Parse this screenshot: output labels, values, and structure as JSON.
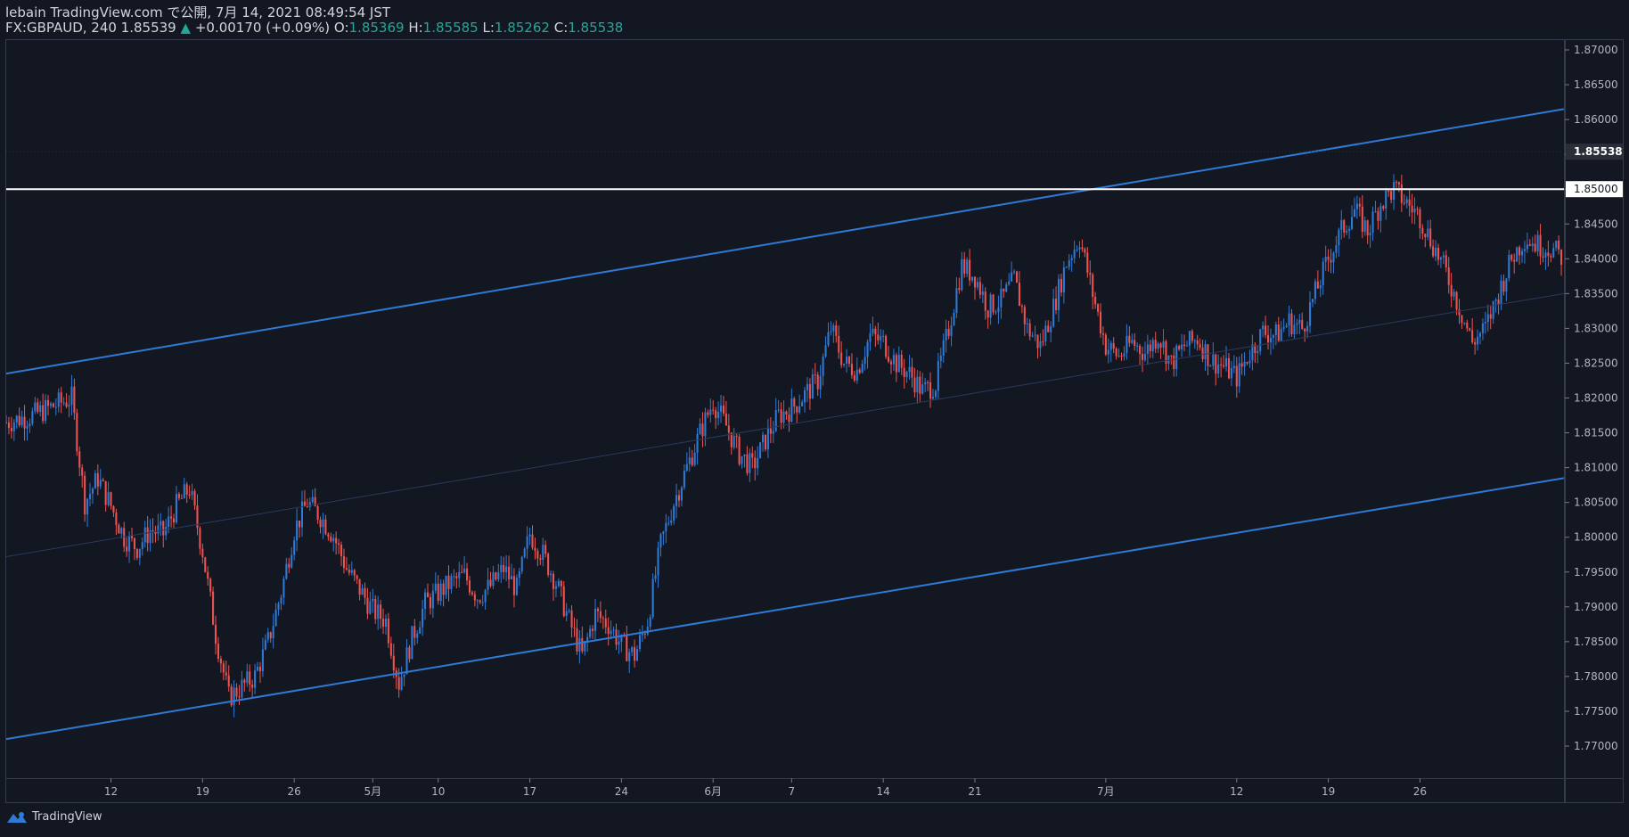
{
  "header": {
    "line1": "lebain TradingView.com で公開, 7月 14, 2021 08:49:54 JST",
    "symbol_prefix": "FX:GBPAUD, 240 1.85539",
    "change_arrow": "▲",
    "change": "+0.00170 (+0.09%)",
    "o_label": "O:",
    "o_value": "1.85369",
    "h_label": "H:",
    "h_value": "1.85585",
    "l_label": "L:",
    "l_value": "1.85262",
    "c_label": "C:",
    "c_value": "1.85538"
  },
  "footer": {
    "brand": "TradingView",
    "logo_icon": "tradingview-logo-icon"
  },
  "colors": {
    "background": "#131722",
    "up": "#2f7ad6",
    "down": "#ef5350",
    "trendline": "#2f7ad6",
    "level": "#ffffff",
    "text": "#d1d4dc",
    "teal": "#26a69a"
  },
  "chart_data": {
    "type": "candlestick",
    "symbol": "FX:GBPAUD",
    "interval": "240",
    "ylim": [
      1.765,
      1.874
    ],
    "y_ticks": [
      "1.87000",
      "1.86500",
      "1.86000",
      "1.85500",
      "1.85000",
      "1.84500",
      "1.84000",
      "1.83500",
      "1.83000",
      "1.82500",
      "1.82000",
      "1.81500",
      "1.81000",
      "1.80500",
      "1.80000",
      "1.79500",
      "1.79000",
      "1.78500",
      "1.78000",
      "1.77500",
      "1.77000"
    ],
    "x_ticks": [
      {
        "label": "12",
        "day": 12
      },
      {
        "label": "19",
        "day": 19
      },
      {
        "label": "26",
        "day": 26
      },
      {
        "label": "5月",
        "day": 32
      },
      {
        "label": "10",
        "day": 37
      },
      {
        "label": "17",
        "day": 44
      },
      {
        "label": "24",
        "day": 51
      },
      {
        "label": "6月",
        "day": 58
      },
      {
        "label": "7",
        "day": 64
      },
      {
        "label": "14",
        "day": 71
      },
      {
        "label": "21",
        "day": 78
      },
      {
        "label": "7月",
        "day": 88
      },
      {
        "label": "12",
        "day": 98
      },
      {
        "label": "19",
        "day": 105
      },
      {
        "label": "26",
        "day": 112
      }
    ],
    "x_range_days": [
      4,
      123
    ],
    "last_price_label": "1.85538",
    "horizontal_level": {
      "price": 1.85,
      "label": "1.85000"
    },
    "channel_lines": [
      {
        "name": "upper",
        "p1": {
          "day": 4,
          "price": 1.8235
        },
        "p2": {
          "day": 123,
          "price": 1.8615
        }
      },
      {
        "name": "lower",
        "p1": {
          "day": 4,
          "price": 1.771
        },
        "p2": {
          "day": 123,
          "price": 1.8085
        }
      },
      {
        "name": "mid",
        "p1": {
          "day": 4,
          "price": 1.7972
        },
        "p2": {
          "day": 123,
          "price": 1.835
        }
      }
    ],
    "close_path": [
      [
        4,
        1.8165
      ],
      [
        6,
        1.8175
      ],
      [
        8,
        1.8192
      ],
      [
        9,
        1.82
      ],
      [
        10,
        1.805
      ],
      [
        11,
        1.8085
      ],
      [
        12,
        1.8045
      ],
      [
        13,
        1.8
      ],
      [
        14,
        1.7985
      ],
      [
        15,
        1.801
      ],
      [
        16,
        1.8005
      ],
      [
        17,
        1.8045
      ],
      [
        18,
        1.807
      ],
      [
        19,
        1.798
      ],
      [
        20,
        1.786
      ],
      [
        21,
        1.777
      ],
      [
        22,
        1.7785
      ],
      [
        23,
        1.78
      ],
      [
        24,
        1.785
      ],
      [
        25,
        1.792
      ],
      [
        26,
        1.801
      ],
      [
        27,
        1.805
      ],
      [
        28,
        1.803
      ],
      [
        29,
        1.8002
      ],
      [
        30,
        1.7955
      ],
      [
        31,
        1.7925
      ],
      [
        32,
        1.7895
      ],
      [
        33,
        1.788
      ],
      [
        34,
        1.779
      ],
      [
        35,
        1.7855
      ],
      [
        36,
        1.7905
      ],
      [
        37,
        1.792
      ],
      [
        38,
        1.7935
      ],
      [
        39,
        1.7945
      ],
      [
        40,
        1.7915
      ],
      [
        41,
        1.793
      ],
      [
        42,
        1.7955
      ],
      [
        43,
        1.7925
      ],
      [
        44,
        1.8005
      ],
      [
        45,
        1.7975
      ],
      [
        46,
        1.7935
      ],
      [
        47,
        1.788
      ],
      [
        48,
        1.783
      ],
      [
        49,
        1.789
      ],
      [
        50,
        1.7875
      ],
      [
        51,
        1.7845
      ],
      [
        52,
        1.783
      ],
      [
        53,
        1.788
      ],
      [
        54,
        1.799
      ],
      [
        55,
        1.805
      ],
      [
        56,
        1.81
      ],
      [
        57,
        1.815
      ],
      [
        58,
        1.8195
      ],
      [
        59,
        1.816
      ],
      [
        60,
        1.812
      ],
      [
        61,
        1.81
      ],
      [
        62,
        1.814
      ],
      [
        63,
        1.8175
      ],
      [
        64,
        1.8185
      ],
      [
        65,
        1.8205
      ],
      [
        66,
        1.8225
      ],
      [
        67,
        1.83
      ],
      [
        68,
        1.825
      ],
      [
        69,
        1.824
      ],
      [
        70,
        1.829
      ],
      [
        71,
        1.828
      ],
      [
        72,
        1.825
      ],
      [
        73,
        1.8235
      ],
      [
        74,
        1.821
      ],
      [
        75,
        1.822
      ],
      [
        76,
        1.83
      ],
      [
        77,
        1.839
      ],
      [
        78,
        1.8375
      ],
      [
        79,
        1.833
      ],
      [
        80,
        1.834
      ],
      [
        81,
        1.837
      ],
      [
        82,
        1.83
      ],
      [
        83,
        1.8275
      ],
      [
        84,
        1.833
      ],
      [
        85,
        1.8395
      ],
      [
        86,
        1.843
      ],
      [
        87,
        1.835
      ],
      [
        88,
        1.8275
      ],
      [
        89,
        1.826
      ],
      [
        90,
        1.828
      ],
      [
        91,
        1.8265
      ],
      [
        92,
        1.829
      ],
      [
        93,
        1.825
      ],
      [
        94,
        1.8275
      ],
      [
        95,
        1.8285
      ],
      [
        96,
        1.8255
      ],
      [
        97,
        1.8245
      ],
      [
        98,
        1.823
      ],
      [
        99,
        1.8265
      ],
      [
        100,
        1.8295
      ],
      [
        101,
        1.829
      ],
      [
        102,
        1.831
      ],
      [
        103,
        1.83
      ],
      [
        104,
        1.835
      ],
      [
        105,
        1.84
      ],
      [
        106,
        1.844
      ],
      [
        107,
        1.847
      ],
      [
        108,
        1.844
      ],
      [
        109,
        1.848
      ],
      [
        110,
        1.85
      ],
      [
        111,
        1.848
      ],
      [
        112,
        1.846
      ],
      [
        113,
        1.842
      ],
      [
        114,
        1.838
      ],
      [
        115,
        1.833
      ],
      [
        116,
        1.828
      ],
      [
        117,
        1.83
      ],
      [
        118,
        1.835
      ],
      [
        119,
        1.84
      ],
      [
        120,
        1.843
      ],
      [
        121,
        1.842
      ],
      [
        122,
        1.8415
      ],
      [
        123,
        1.84
      ]
    ]
  }
}
